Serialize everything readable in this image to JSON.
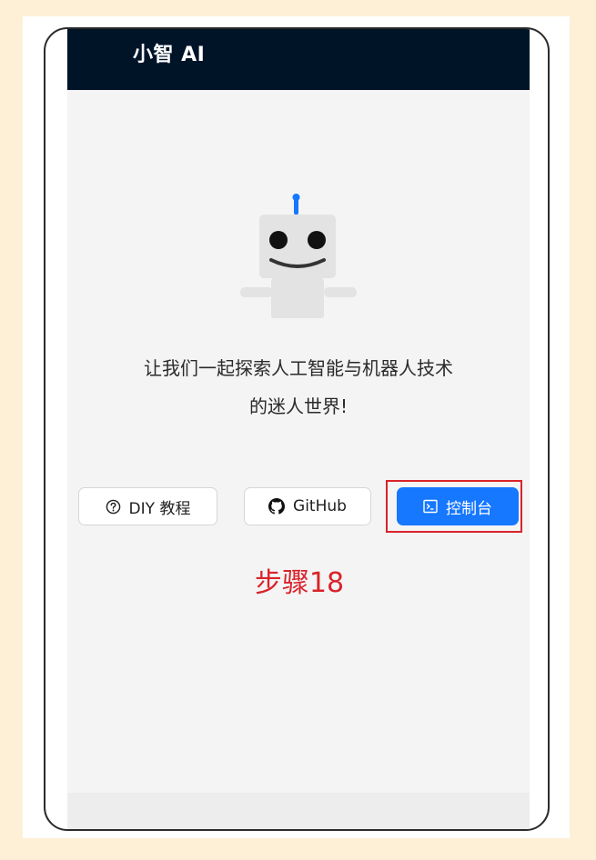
{
  "header": {
    "title": "小智 AI"
  },
  "main": {
    "tagline_line1": "让我们一起探索人工智能与机器人技术",
    "tagline_line2": "的迷人世界!",
    "buttons": {
      "diy_label": "DIY 教程",
      "github_label": "GitHub",
      "console_label": "控制台"
    }
  },
  "annotation": {
    "step_label": "步骤18"
  },
  "colors": {
    "header_bg": "#001428",
    "primary_button": "#1677ff",
    "highlight": "#d9232a"
  },
  "icons": {
    "diy": "question-circle-icon",
    "github": "github-icon",
    "console": "terminal-icon",
    "mascot": "robot-icon"
  }
}
